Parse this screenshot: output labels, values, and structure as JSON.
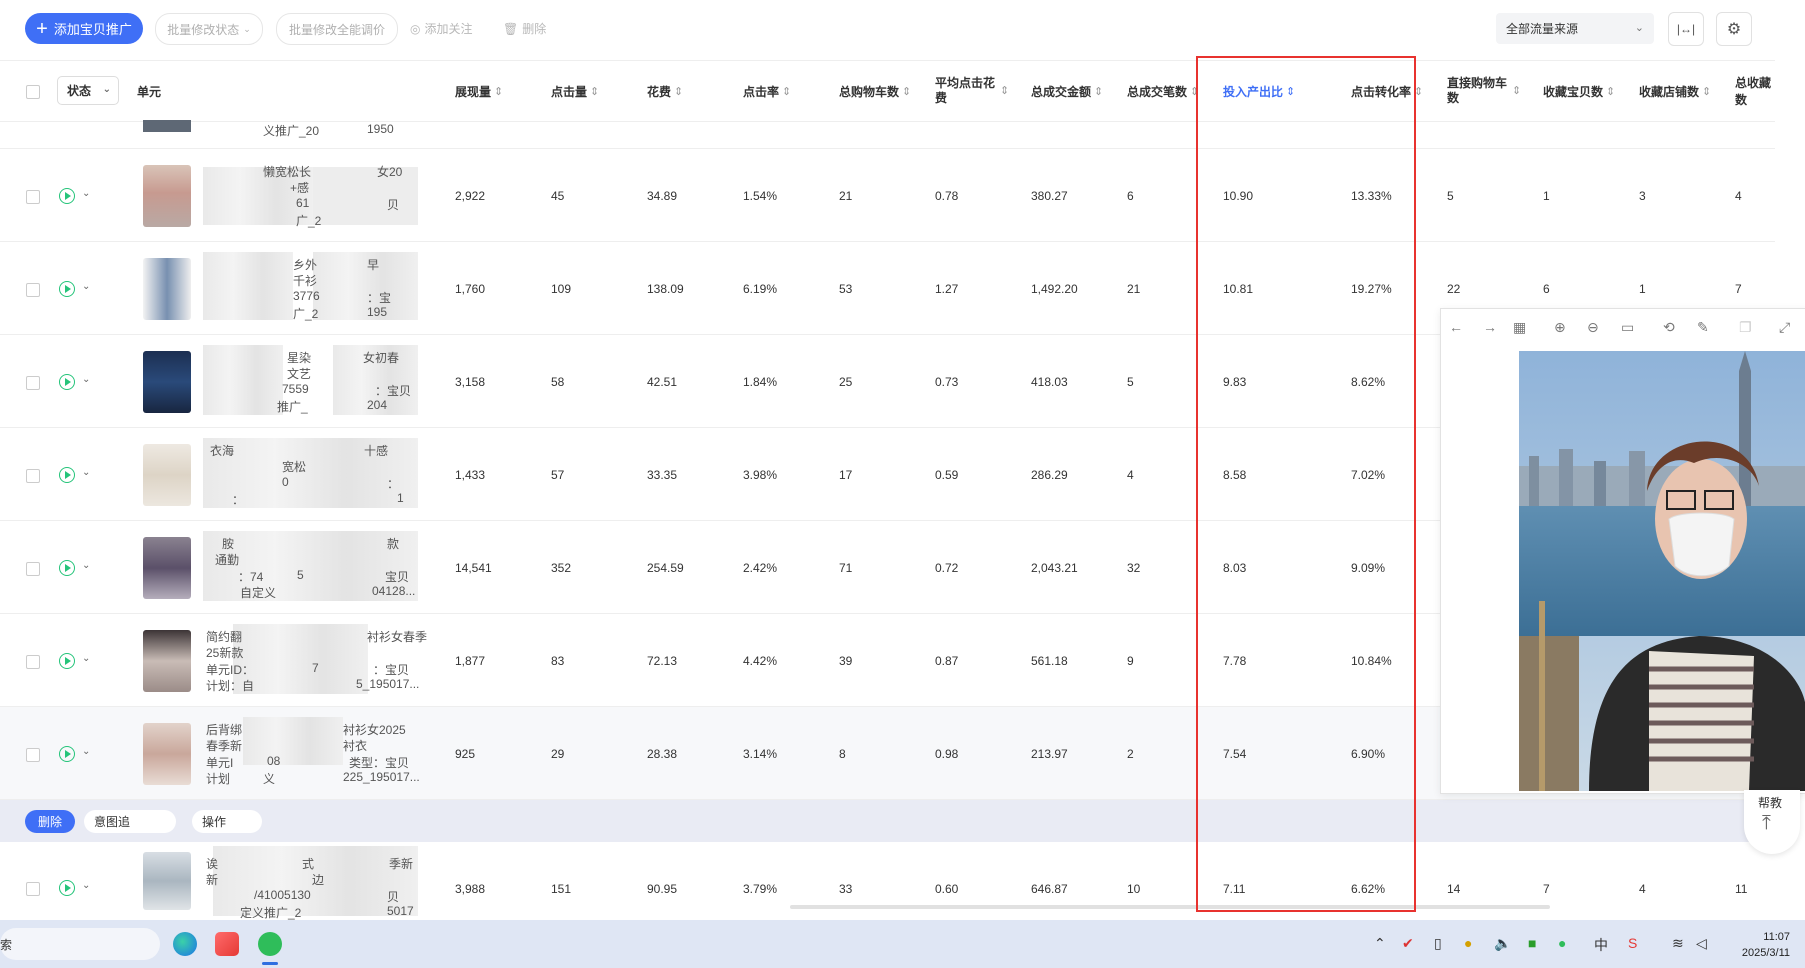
{
  "toolbar": {
    "add_label": "添加宝贝推广",
    "batch_status": "批量修改状态",
    "batch_price": "批量修改全能调价",
    "follow": "添加关注",
    "delete": "删除",
    "source_select": "全部流量来源"
  },
  "header": {
    "status": "状态",
    "unit": "单元",
    "columns": [
      "展现量",
      "点击量",
      "花费",
      "点击率",
      "总购物车数",
      "平均点击花费",
      "总成交金额",
      "总成交笔数",
      "投入产出比",
      "点击转化率",
      "直接购物车数",
      "收藏宝贝数",
      "收藏店铺数",
      "总收藏数"
    ]
  },
  "top_partial": {
    "text": "义推广_20",
    "code": "1950"
  },
  "rows": [
    {
      "frags": [
        "懒宽松长",
        "女20",
        "+感",
        "61",
        "贝",
        "广_2"
      ],
      "values": [
        "2,922",
        "45",
        "34.89",
        "1.54%",
        "21",
        "0.78",
        "380.27",
        "6",
        "10.90",
        "13.33%",
        "5",
        "1",
        "3",
        "4"
      ]
    },
    {
      "frags": [
        "乡外",
        "早",
        "千衫",
        "3776",
        "：宝",
        "广_2",
        "195"
      ],
      "values": [
        "1,760",
        "109",
        "138.09",
        "6.19%",
        "53",
        "1.27",
        "1,492.20",
        "21",
        "10.81",
        "19.27%",
        "22",
        "6",
        "1",
        "7"
      ]
    },
    {
      "frags": [
        "星染",
        "女初春",
        "文艺",
        "7559",
        "：宝贝",
        "推广_",
        "204"
      ],
      "values": [
        "3,158",
        "58",
        "42.51",
        "1.84%",
        "25",
        "0.73",
        "418.03",
        "5",
        "9.83",
        "8.62%",
        "",
        "",
        "",
        ""
      ]
    },
    {
      "frags": [
        "衣海",
        "十感",
        "宽松",
        "0",
        "：",
        "：",
        "1"
      ],
      "values": [
        "1,433",
        "57",
        "33.35",
        "3.98%",
        "17",
        "0.59",
        "286.29",
        "4",
        "8.58",
        "7.02%",
        "",
        "",
        "",
        ""
      ]
    },
    {
      "frags": [
        "胺",
        "款",
        "通勤",
        "：74",
        "5",
        "宝贝",
        "自定义",
        "04128..."
      ],
      "values": [
        "14,541",
        "352",
        "254.59",
        "2.42%",
        "71",
        "0.72",
        "2,043.21",
        "32",
        "8.03",
        "9.09%",
        "",
        "",
        "",
        ""
      ]
    },
    {
      "frags": [
        "简约翻",
        "衬衫女春季",
        "25新款",
        "单元ID：",
        "7",
        "：宝贝",
        "计划：自",
        "5_195017..."
      ],
      "values": [
        "1,877",
        "83",
        "72.13",
        "4.42%",
        "39",
        "0.87",
        "561.18",
        "9",
        "7.78",
        "10.84%",
        "",
        "",
        "",
        ""
      ]
    },
    {
      "frags": [
        "后背绑",
        "衬衫女2025",
        "春季新",
        "衬衣",
        "单元I",
        "08",
        "类型：宝贝",
        "计划",
        "义",
        "225_195017..."
      ],
      "values": [
        "925",
        "29",
        "28.38",
        "3.14%",
        "8",
        "0.98",
        "213.97",
        "2",
        "7.54",
        "6.90%",
        "",
        "",
        "",
        ""
      ]
    },
    {
      "frags": [
        "诶",
        "式",
        "季新",
        "新",
        "边",
        "/41005130",
        "贝",
        "定义推广_2",
        "5017"
      ],
      "values": [
        "3,988",
        "151",
        "90.95",
        "3.79%",
        "33",
        "0.60",
        "646.87",
        "10",
        "7.11",
        "6.62%",
        "14",
        "7",
        "4",
        "11"
      ]
    }
  ],
  "action_bar": {
    "delete": "删除",
    "intent": "意图追",
    "operate": "操作"
  },
  "side": {
    "label": "帮教"
  },
  "taskbar": {
    "search": "索",
    "time": "11:07",
    "date": "2025/3/11",
    "ime": "中"
  },
  "colors": {
    "accent": "#3f6ff6",
    "highlight": "#e8322f",
    "play": "#25c47a"
  },
  "icons": [
    "plus-icon",
    "eye-icon",
    "trash-icon",
    "chevron-down-icon",
    "column-width-icon",
    "gear-icon",
    "play-icon",
    "arrow-left-icon",
    "arrow-right-icon",
    "grid-icon",
    "zoom-in-icon",
    "zoom-out-icon",
    "fit-icon",
    "rotate-icon",
    "edit-icon",
    "copy-icon",
    "fullscreen-icon",
    "back-to-top-icon"
  ]
}
